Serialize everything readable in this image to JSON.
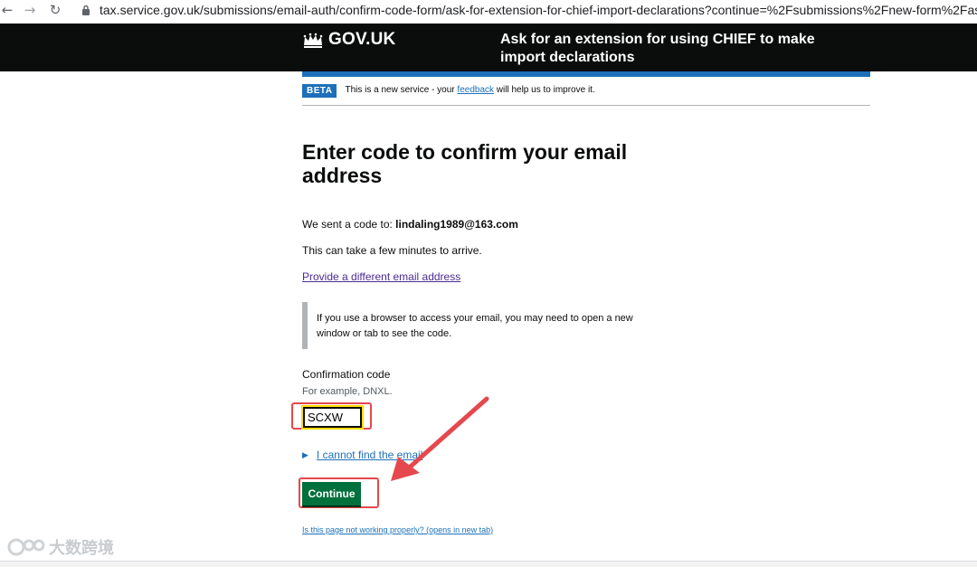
{
  "browser": {
    "url": "tax.service.gov.uk/submissions/email-auth/confirm-code-form/ask-for-extension-for-chief-import-declarations?continue=%2Fsubmissions%2Fnew-form%2Fask-for-e"
  },
  "header": {
    "logo_text": "GOV.UK",
    "service_name": "Ask for an extension for using CHIEF to make import declarations"
  },
  "phase_banner": {
    "tag": "BETA",
    "text_before": "This is a new service - your ",
    "feedback_link": "feedback",
    "text_after": " will help us to improve it."
  },
  "main": {
    "title": "Enter code to confirm your email address",
    "sent_label": "We sent a code to: ",
    "email": "lindaling1989@163.com",
    "arrive_text": "This can take a few minutes to arrive.",
    "different_email_link": "Provide a different email address",
    "inset_text": "If you use a browser to access your email, you may need to open a new window or tab to see the code.",
    "field_label": "Confirmation code",
    "field_hint": "For example, DNXL.",
    "field_value": "SCXW",
    "details_summary": "I cannot find the email",
    "continue_label": "Continue",
    "report_link": "Is this page not working properly? (opens in new tab)"
  },
  "watermark": {
    "text": "大数跨境"
  },
  "colors": {
    "header_bg": "#0b0c0c",
    "brand_blue": "#1d70b8",
    "button_green": "#00703c",
    "annotation_red": "#e5484d",
    "focus_yellow": "#ffdd00"
  }
}
